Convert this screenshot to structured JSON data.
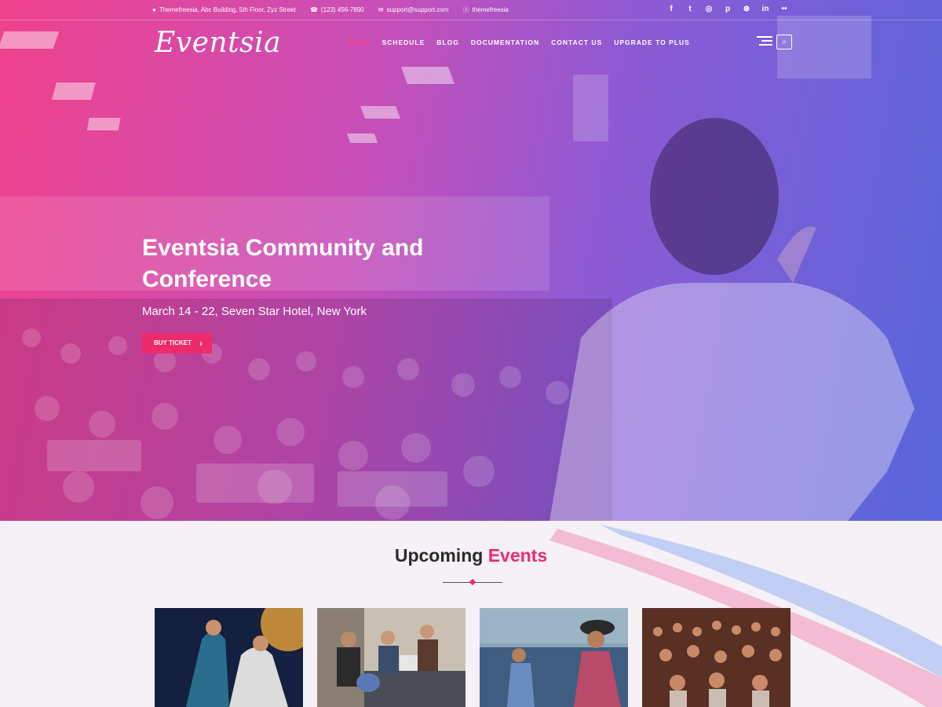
{
  "topbar": {
    "address": "Themefreesia, Abc Building, 5th Floor, Zyz Street",
    "phone": "(123) 456-7890",
    "email": "support@support.com",
    "skype": "themefreesia",
    "social": [
      {
        "icon": "facebook-icon",
        "glyph": "f"
      },
      {
        "icon": "twitter-icon",
        "glyph": "t"
      },
      {
        "icon": "instagram-icon",
        "glyph": "◎"
      },
      {
        "icon": "pinterest-icon",
        "glyph": "p"
      },
      {
        "icon": "dribbble-icon",
        "glyph": "⊛"
      },
      {
        "icon": "linkedin-icon",
        "glyph": "in"
      },
      {
        "icon": "flickr-icon",
        "glyph": "••"
      }
    ]
  },
  "logo": "Eventsia",
  "nav": [
    "HOME",
    "SCHEDULE",
    "BLOG",
    "DOCUMENTATION",
    "CONTACT US",
    "UPGRADE TO PLUS"
  ],
  "hero": {
    "title": "Eventsia Community and Conference",
    "subtitle": "March 14 - 22, Seven Star Hotel, New York",
    "button": "BUY TICKET"
  },
  "events": {
    "title_main": "Upcoming",
    "title_accent": "Events"
  },
  "colors": {
    "accent": "#ee2a6e",
    "gradient_left": "#f0428d",
    "gradient_right": "#5866db",
    "section_bg": "#f6f1f6"
  }
}
